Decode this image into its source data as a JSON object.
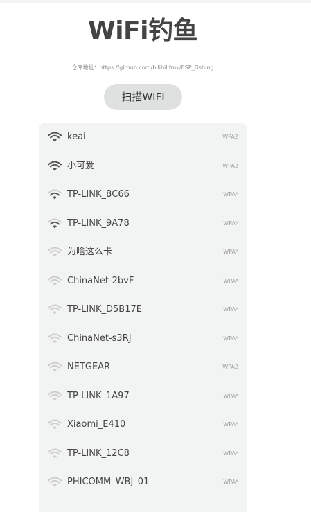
{
  "title": "WiFi钓鱼",
  "repo_text": "仓库地址：https://github.com/bilibilifmk/ESP_Fishing",
  "scan_button": "扫描WIFI",
  "networks": [
    {
      "ssid": "keai",
      "security": "WPA2",
      "signal": 3
    },
    {
      "ssid": "小可爱",
      "security": "WPA2",
      "signal": 3
    },
    {
      "ssid": "TP-LINK_8C66",
      "security": "WPA*",
      "signal": 2
    },
    {
      "ssid": "TP-LINK_9A78",
      "security": "WPA*",
      "signal": 2
    },
    {
      "ssid": "为啥这么卡",
      "security": "WPA*",
      "signal": 1
    },
    {
      "ssid": "ChinaNet-2bvF",
      "security": "WPA*",
      "signal": 1
    },
    {
      "ssid": "TP-LINK_D5B17E",
      "security": "WPA*",
      "signal": 1
    },
    {
      "ssid": "ChinaNet-s3RJ",
      "security": "WPA*",
      "signal": 1
    },
    {
      "ssid": "NETGEAR",
      "security": "WPA2",
      "signal": 1
    },
    {
      "ssid": "TP-LINK_1A97",
      "security": "WPA*",
      "signal": 1
    },
    {
      "ssid": "Xiaomi_E410",
      "security": "WPA*",
      "signal": 1
    },
    {
      "ssid": "TP-LINK_12C8",
      "security": "WPA*",
      "signal": 1
    },
    {
      "ssid": "PHICOMM_WBJ_01",
      "security": "WPA*",
      "signal": 1
    }
  ],
  "icon_name": "wifi-signal-icon",
  "colors": {
    "signal_active": "#555555",
    "signal_inactive": "#cccccc",
    "list_background": "#f2f3f3",
    "button_background": "#dfe0e0"
  }
}
